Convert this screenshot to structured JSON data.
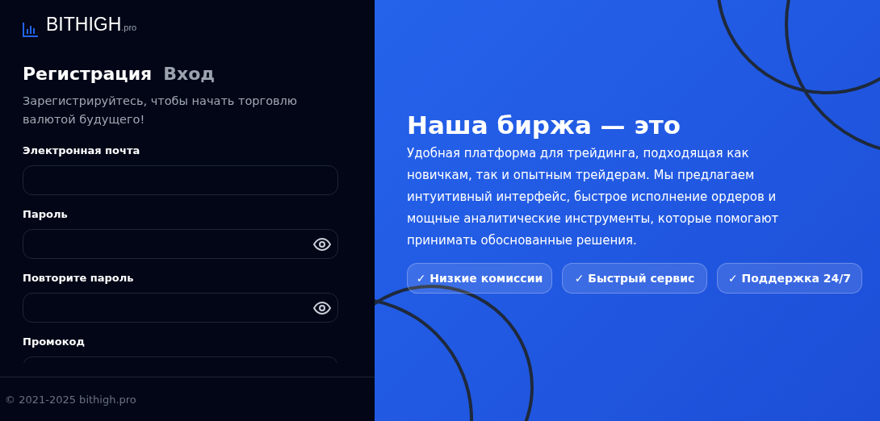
{
  "logo": {
    "name": "BITHIGH",
    "suffix": ".pro"
  },
  "tabs": [
    {
      "label": "Регистрация",
      "selected": true
    },
    {
      "label": "Вход",
      "selected": false
    }
  ],
  "subtitle": "Зарегистрируйтесь, чтобы начать торговлю валютой будущего!",
  "fields": [
    {
      "label": "Электронная почта",
      "kind": "text"
    },
    {
      "label": "Пароль",
      "kind": "password"
    },
    {
      "label": "Повторите пароль",
      "kind": "password"
    },
    {
      "label": "Промокод",
      "kind": "text"
    }
  ],
  "footer": "© 2021-2025 bithigh.pro",
  "promo": {
    "heading": "Наша биржа — это",
    "text": "Удобная платформа для трейдинга, подходящая как новичкам, так и опытным трейдерам. Мы предлагаем интуитивный интерфейс, быстрое исполнение ордеров и мощные аналитические инструменты, которые помогают принимать обоснованные решения.",
    "features": [
      "✓ Низкие комиссии",
      "✓ Быстрый сервис",
      "✓ Поддержка 24/7"
    ]
  }
}
